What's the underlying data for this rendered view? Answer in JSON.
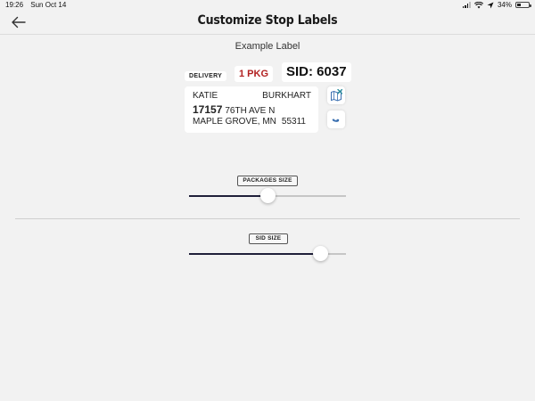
{
  "status_bar": {
    "time": "19:26",
    "date": "Sun Oct 14",
    "battery": "34%"
  },
  "nav": {
    "title": "Customize Stop Labels",
    "back_icon": "arrow-left-icon"
  },
  "example": {
    "title": "Example Label",
    "delivery": "DELIVERY",
    "packages": "1 PKG",
    "sid": "SID: 6037",
    "first_name": "KATIE",
    "last_name": "BURKHART",
    "street_number": "17157",
    "street_name": "76TH AVE N",
    "city_state": "MAPLE GROVE, MN",
    "zip": "55311",
    "map_icon": "map-icon",
    "phone_icon": "phone-icon"
  },
  "sliders": {
    "packages_size": {
      "label": "PACKAGES SIZE",
      "value": 0.5
    },
    "sid_size": {
      "label": "SID SIZE",
      "value": 0.84
    }
  },
  "colors": {
    "package_red": "#b22222",
    "track_fill": "#1f1f3a",
    "background": "#f2f2f2"
  }
}
